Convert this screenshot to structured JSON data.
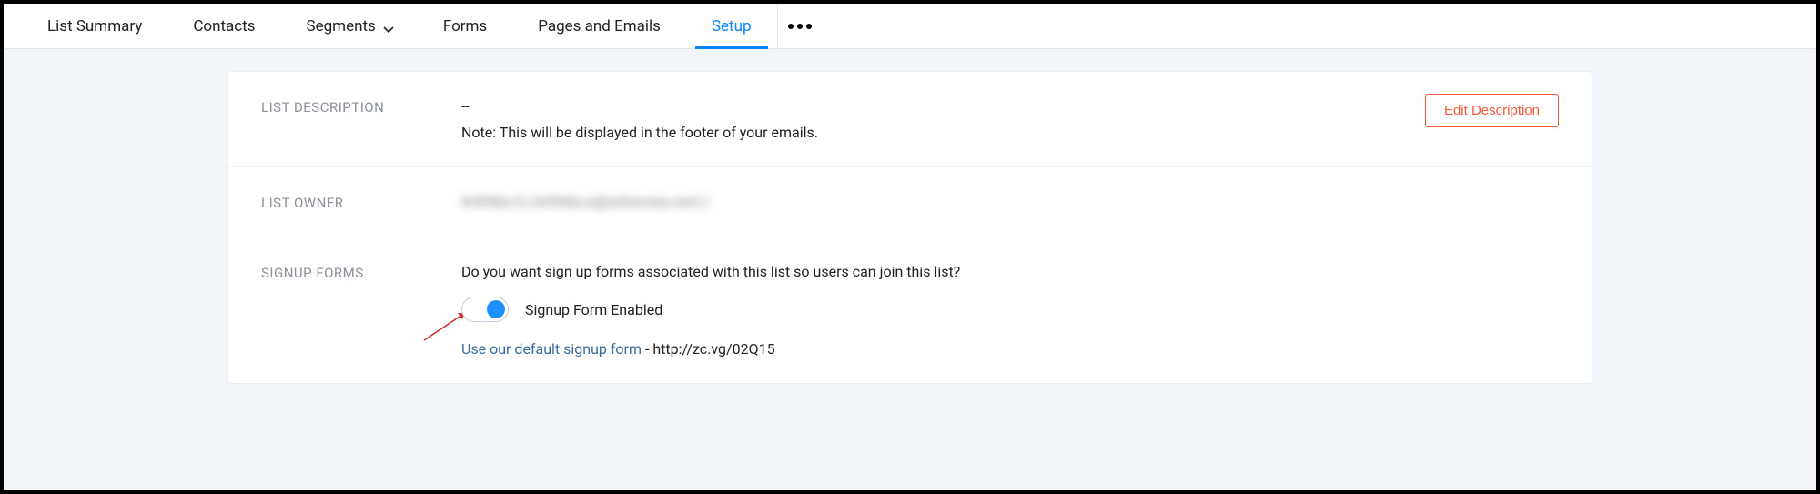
{
  "tabs": {
    "items": [
      {
        "label": "List Summary",
        "has_chevron": false,
        "active": false
      },
      {
        "label": "Contacts",
        "has_chevron": false,
        "active": false
      },
      {
        "label": "Segments",
        "has_chevron": true,
        "active": false
      },
      {
        "label": "Forms",
        "has_chevron": false,
        "active": false
      },
      {
        "label": "Pages and Emails",
        "has_chevron": false,
        "active": false
      },
      {
        "label": "Setup",
        "has_chevron": false,
        "active": true
      }
    ]
  },
  "description": {
    "heading": "LIST DESCRIPTION",
    "value": "--",
    "note": "Note: This will be displayed in the footer of your emails.",
    "edit_button": "Edit Description"
  },
  "owner": {
    "heading": "LIST OWNER",
    "value": "Krithika S ( krithika.s@zohocorp.com )"
  },
  "signup": {
    "heading": "SIGNUP FORMS",
    "question": "Do you want sign up forms associated with this list so users can join this list?",
    "toggle_label": "Signup Form Enabled",
    "toggle_on": true,
    "link_text": "Use our default signup form",
    "link_sep": " - ",
    "link_url": "http://zc.vg/02Q15"
  }
}
